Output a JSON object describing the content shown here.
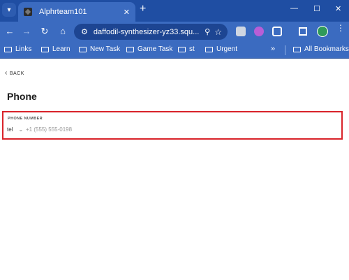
{
  "browser": {
    "tab_title": "Alphrteam101",
    "url": "daffodil-synthesizer-yz33.squ...",
    "bookmarks": [
      "Links",
      "Learn",
      "New Task",
      "Game Task",
      "st",
      "Urgent"
    ],
    "all_bookmarks": "All Bookmarks"
  },
  "page": {
    "back_label": "BACK",
    "title": "Phone",
    "phone": {
      "label": "PHONE NUMBER",
      "type_value": "tel",
      "placeholder": "+1 (555) 555-0198",
      "value": ""
    }
  },
  "colors": {
    "chrome": "#3b6bc0",
    "highlight": "#d9232a"
  }
}
